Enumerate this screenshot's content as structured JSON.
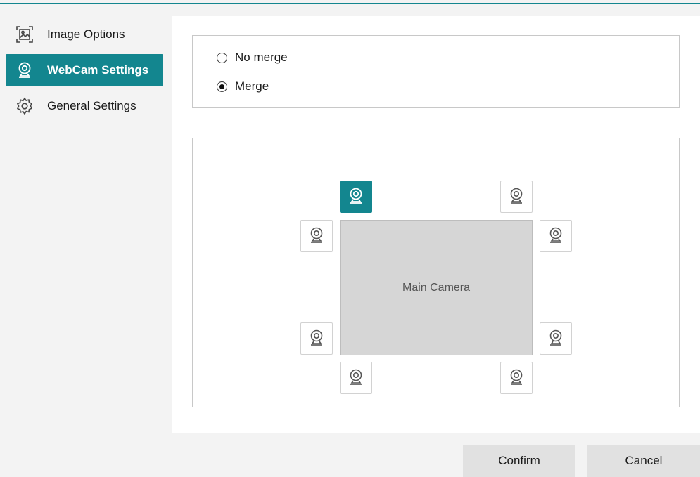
{
  "sidebar": {
    "items": [
      {
        "label": "Image Options",
        "icon": "image-options-icon",
        "active": false
      },
      {
        "label": "WebCam Settings",
        "icon": "webcam-icon",
        "active": true
      },
      {
        "label": "General Settings",
        "icon": "gear-icon",
        "active": false
      }
    ]
  },
  "merge": {
    "options": [
      {
        "label": "No merge",
        "checked": false
      },
      {
        "label": "Merge",
        "checked": true
      }
    ]
  },
  "layout": {
    "main_label": "Main Camera",
    "slots": [
      {
        "position": "top-left",
        "selected": true
      },
      {
        "position": "top-right",
        "selected": false
      },
      {
        "position": "left-top",
        "selected": false
      },
      {
        "position": "right-top",
        "selected": false
      },
      {
        "position": "left-bottom",
        "selected": false
      },
      {
        "position": "right-bottom",
        "selected": false
      },
      {
        "position": "bottom-left",
        "selected": false
      },
      {
        "position": "bottom-right",
        "selected": false
      }
    ]
  },
  "footer": {
    "confirm_label": "Confirm",
    "cancel_label": "Cancel"
  },
  "colors": {
    "accent": "#13868f",
    "main_camera_bg": "#d6d6d6",
    "button_bg": "#e1e1e1"
  }
}
